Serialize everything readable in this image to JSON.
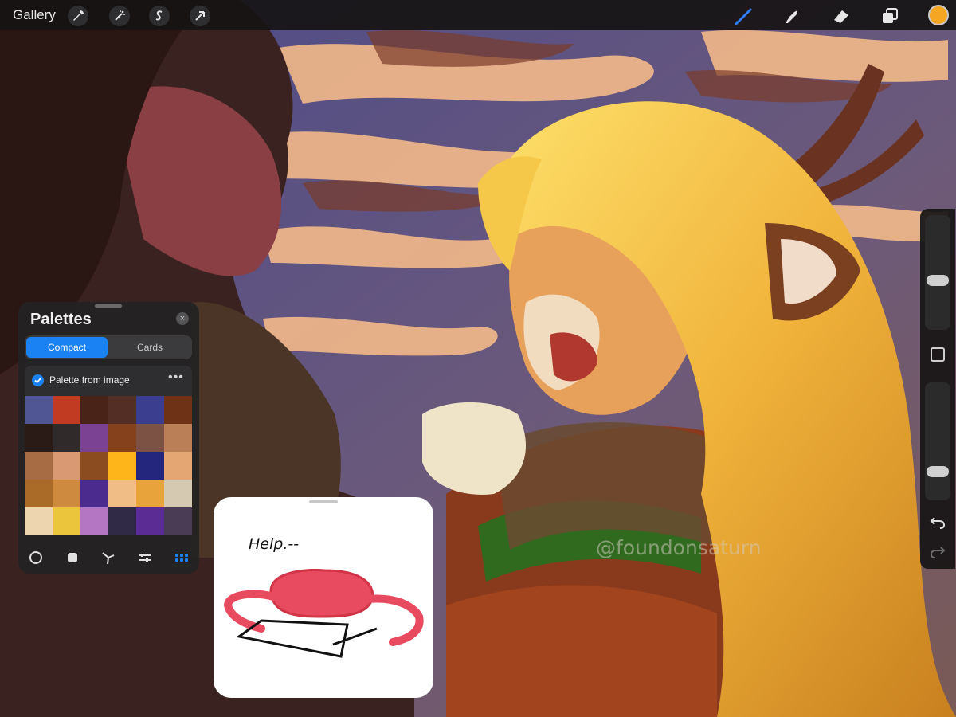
{
  "toolbar": {
    "gallery_label": "Gallery",
    "actions_icon": "wrench-icon",
    "adjustments_icon": "magic-wand-icon",
    "selection_icon": "selection-s-icon",
    "transform_icon": "arrow-cursor-icon",
    "brush_icon": "brush-icon",
    "smudge_icon": "smudge-icon",
    "eraser_icon": "eraser-icon",
    "layers_icon": "layers-icon",
    "current_color": "#f5a623",
    "brush_color": "#2f7ef6"
  },
  "sidebar": {
    "brush_size_slider": {
      "level": 0.42
    },
    "opacity_slider": {
      "level": 0.22
    },
    "undo_icon": "undo-icon",
    "redo_icon": "redo-icon"
  },
  "palettes": {
    "title": "Palettes",
    "tabs": {
      "compact": "Compact",
      "cards": "Cards"
    },
    "palette_name": "Palette from image",
    "more": "•••",
    "swatches": [
      "#505694",
      "#c03b22",
      "#4a2318",
      "#532e24",
      "#3b3d8f",
      "#6e3217",
      "#2a1b17",
      "#302a2a",
      "#7b4193",
      "#85401c",
      "#7c5245",
      "#bb7f58",
      "#a86c45",
      "#d99a73",
      "#8b4c1f",
      "#fdb51a",
      "#24267d",
      "#e4a774",
      "#ab6b28",
      "#ce8a3e",
      "#4b2c8e",
      "#f0bd87",
      "#e8a43b",
      "#d6c9b2",
      "#edd6af",
      "#ebc53c",
      "#b475c2",
      "#312a46",
      "#5b2c93",
      "#4b3c56"
    ],
    "tools": [
      "disc-icon",
      "classic-icon",
      "harmony-icon",
      "value-icon",
      "palettes-grid-icon"
    ]
  },
  "reference": {
    "text": "Help.--"
  },
  "watermark": "@foundonsaturn"
}
